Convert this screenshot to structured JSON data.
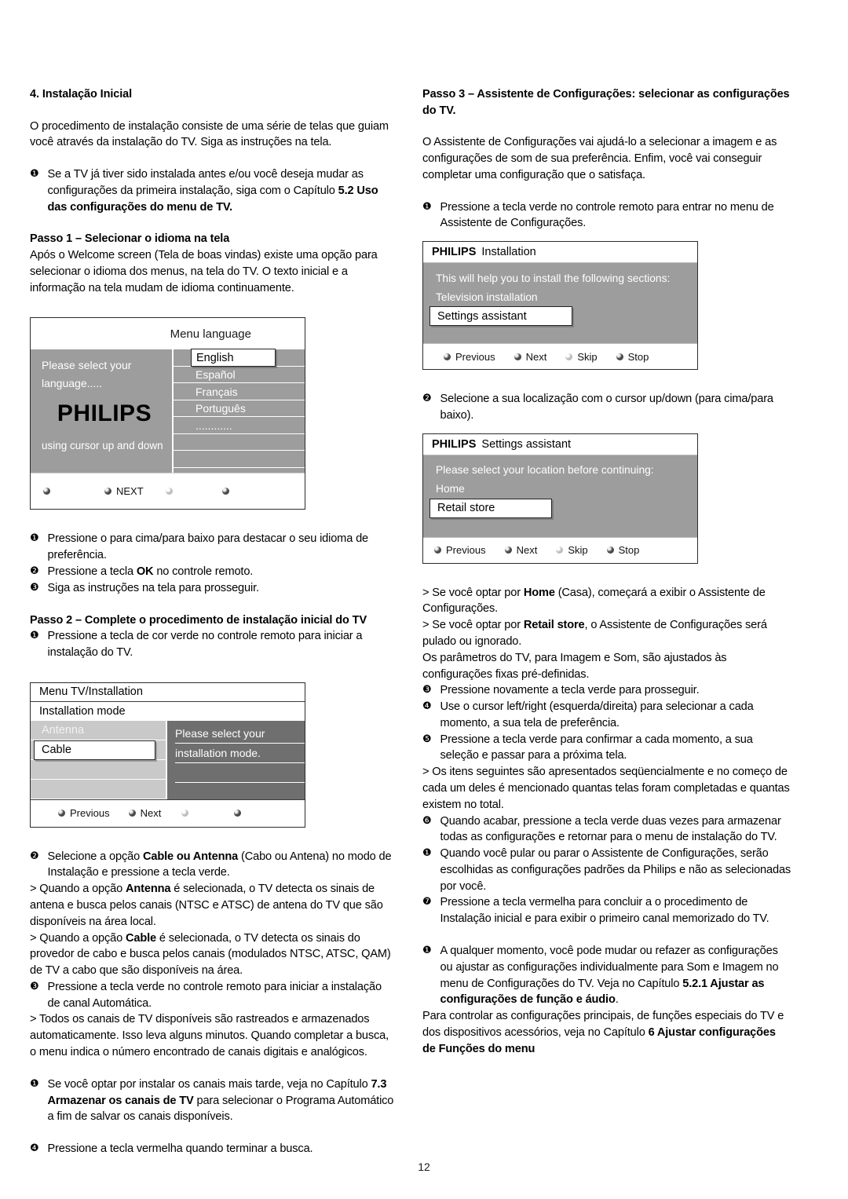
{
  "page": {
    "number": "12"
  },
  "left_column": {
    "section_title": "4. Instalação Inicial",
    "intro": "O procedimento de instalação consiste de uma série de telas que guiam você através da instalação do TV. Siga as instruções na tela.",
    "note_1_marker": "❶",
    "note_1_a": "Se a TV já tiver sido instalada antes e/ou você deseja mudar as configurações da primeira instalação, siga com o Capítulo ",
    "note_1_bold": "5.2 Uso das configurações do menu de TV.",
    "step1_title": "Passo 1 – Selecionar o idioma na tela",
    "step1_text": "Após o Welcome screen (Tela de boas vindas) existe uma opção para selecionar o idioma dos menus, na tela do TV. O texto inicial e a informação na tela mudam de idioma continuamente.",
    "bullets_after_fig1": [
      {
        "marker": "❶",
        "text": "Pressione o para cima/para baixo para destacar o seu idioma de preferência."
      },
      {
        "marker": "❷",
        "text_a": "Pressione a tecla ",
        "bold": "OK",
        "text_b": " no controle remoto."
      },
      {
        "marker": "❸",
        "text": "Siga as instruções na tela para prosseguir."
      }
    ],
    "step2_title": "Passo 2 – Complete o procedimento de instalação inicial do TV",
    "step2_bullet1_marker": "❶",
    "step2_bullet1_text": "Pressione a tecla de cor verde no controle remoto para iniciar a instalação do TV.",
    "after_fig2": [
      {
        "kind": "num",
        "marker": "❷",
        "text_a": "Selecione a opção ",
        "bold": "Cable ou Antenna",
        "text_b": " (Cabo ou Antena) no modo de Instalação e pressione a tecla verde."
      },
      {
        "kind": "angle",
        "text_a": "> Quando a opção ",
        "bold": "Antenna",
        "text_b": " é selecionada, o TV detecta os sinais de antena e busca pelos canais (NTSC e ATSC) de antena do TV que são disponíveis na área local."
      },
      {
        "kind": "angle",
        "text_a": "> Quando a opção ",
        "bold": "Cable",
        "text_b": " é selecionada, o TV detecta os sinais do provedor de cabo e busca pelos canais (modulados NTSC, ATSC, QAM) de TV a cabo que são disponíveis na área."
      },
      {
        "kind": "num",
        "marker": "❸",
        "text_a": "Pressione a tecla verde no controle remoto para iniciar a instalação de canal Automática.",
        "bold": "",
        "text_b": ""
      },
      {
        "kind": "angle",
        "text_a": "> Todos os canais de TV disponíveis são rastreados e armazenados automaticamente. Isso leva alguns minutos. Quando completar a busca, o menu indica o número encontrado de canais digitais e analógicos.",
        "bold": "",
        "text_b": ""
      }
    ],
    "note_2_marker": "❶",
    "note_2_a": "Se você optar por instalar os canais mais tarde, veja no Capítulo ",
    "note_2_bold": "7.3 Armazenar os canais de TV",
    "note_2_b": " para selecionar o Programa Automático a fim de salvar os canais disponíveis.",
    "final_bullet_marker": "❹",
    "final_bullet_text": "Pressione a tecla vermelha quando terminar a busca."
  },
  "right_column": {
    "step3_title": "Passo 3 – Assistente de Configurações: selecionar as configurações do TV.",
    "step3_text": "O Assistente de Configurações vai ajudá-lo a selecionar a imagem e as configurações de som de sua preferência. Enfim, você vai conseguir completar uma configuração que o satisfaça.",
    "step3_bullet1_marker": "❶",
    "step3_bullet1_text": "Pressione a tecla verde no controle remoto para entrar no menu de Assistente de Configurações.",
    "step3_bullet2_marker": "❷",
    "step3_bullet2_text": "Selecione a sua localização com o cursor up/down (para cima/para baixo).",
    "after_fig4": [
      {
        "kind": "angle",
        "text_a": "> Se você optar por ",
        "bold": "Home",
        "text_b": " (Casa), começará a exibir o Assistente de Configurações."
      },
      {
        "kind": "angle",
        "text_a": ">  Se você optar por ",
        "bold": "Retail store",
        "text_b": ", o Assistente de Configurações será pulado ou ignorado."
      },
      {
        "kind": "plain",
        "text_a": "Os parâmetros do TV, para Imagem e Som, são ajustados às configurações fixas pré-definidas.",
        "bold": "",
        "text_b": ""
      },
      {
        "kind": "num",
        "marker": "❸",
        "text_a": "Pressione novamente a tecla verde para prosseguir.",
        "bold": "",
        "text_b": ""
      },
      {
        "kind": "num",
        "marker": "❹",
        "text_a": "Use o cursor left/right (esquerda/direita) para selecionar a cada momento, a sua tela de preferência.",
        "bold": "",
        "text_b": ""
      },
      {
        "kind": "num",
        "marker": "❺",
        "text_a": "Pressione a tecla verde para confirmar a cada momento, a sua seleção e passar para a próxima tela.",
        "bold": "",
        "text_b": ""
      },
      {
        "kind": "angle",
        "text_a": ">  Os itens seguintes são apresentados seqüencialmente e no começo de cada um deles é mencionado quantas telas foram completadas e quantas existem no total.",
        "bold": "",
        "text_b": ""
      },
      {
        "kind": "num",
        "marker": "❻",
        "text_a": "Quando acabar, pressione a tecla verde duas vezes para armazenar todas as configurações e retornar para o menu de instalação do TV.",
        "bold": "",
        "text_b": ""
      },
      {
        "kind": "num",
        "marker": "❶",
        "text_a": "Quando você pular ou parar o Assistente de Configurações, serão escolhidas as configurações padrões da Philips e não as selecionadas por você.",
        "bold": "",
        "text_b": ""
      },
      {
        "kind": "num",
        "marker": "❼",
        "text_a": "Pressione a tecla vermelha para concluir a o procedimento de Instalação inicial e para exibir o primeiro canal memorizado do TV.",
        "bold": "",
        "text_b": ""
      }
    ],
    "note_final_marker": "❶",
    "note_final_a": "A qualquer momento, você pode mudar ou refazer as configurações ou ajustar as configurações individualmente para Som e Imagem no menu de Configurações do TV. Veja no Capítulo ",
    "note_final_bold": "5.2.1 Ajustar as configurações de função e áudio",
    "note_final_b": ".",
    "note_final_c": "Para controlar as configurações principais, de funções especiais do TV e dos dispositivos acessórios, veja no Capítulo ",
    "note_final_bold2": "6 Ajustar configurações de Funções do menu"
  },
  "figures": {
    "menu_language": {
      "title": "Menu language",
      "left_line_1": "Please select your",
      "left_line_2": "language.....",
      "brand": "PHILIPS",
      "left_bottom": "using cursor up and down",
      "options": [
        "English",
        "Español",
        "Français",
        "Português",
        "............",
        "",
        ""
      ],
      "selected": "English",
      "nav": [
        {
          "label": "",
          "state": "active"
        },
        {
          "label": "NEXT",
          "state": "active"
        },
        {
          "label": "",
          "state": "faint"
        },
        {
          "label": "",
          "state": "active"
        }
      ]
    },
    "menu_tv_installation": {
      "title": "Menu TV/Installation",
      "subtitle": "Installation mode",
      "options": [
        "Antenna",
        "Cable",
        "",
        ""
      ],
      "selected": "Cable",
      "message_line_1": "Please select your",
      "message_line_2": "installation mode.",
      "nav": [
        {
          "label": "Previous",
          "state": "active"
        },
        {
          "label": "Next",
          "state": "active"
        },
        {
          "label": "",
          "state": "faint"
        },
        {
          "label": "",
          "state": "active"
        }
      ]
    },
    "philips_installation": {
      "brand": "PHILIPS",
      "screen_name": "Installation",
      "line_1": "This will help you to install the following sections:",
      "line_2": "Television installation",
      "selected": "Settings assistant",
      "nav": [
        {
          "label": "Previous",
          "state": "active"
        },
        {
          "label": "Next",
          "state": "active"
        },
        {
          "label": "Skip",
          "state": "faint"
        },
        {
          "label": "Stop",
          "state": "active"
        }
      ]
    },
    "philips_settings_assistant": {
      "brand": "PHILIPS",
      "screen_name": "Settings assistant",
      "line_1": "Please select your location before continuing:",
      "line_2": "Home",
      "selected": "Retail store",
      "nav": [
        {
          "label": "Previous",
          "state": "active"
        },
        {
          "label": "Next",
          "state": "active"
        },
        {
          "label": "Skip",
          "state": "faint"
        },
        {
          "label": "Stop",
          "state": "active"
        }
      ]
    }
  }
}
